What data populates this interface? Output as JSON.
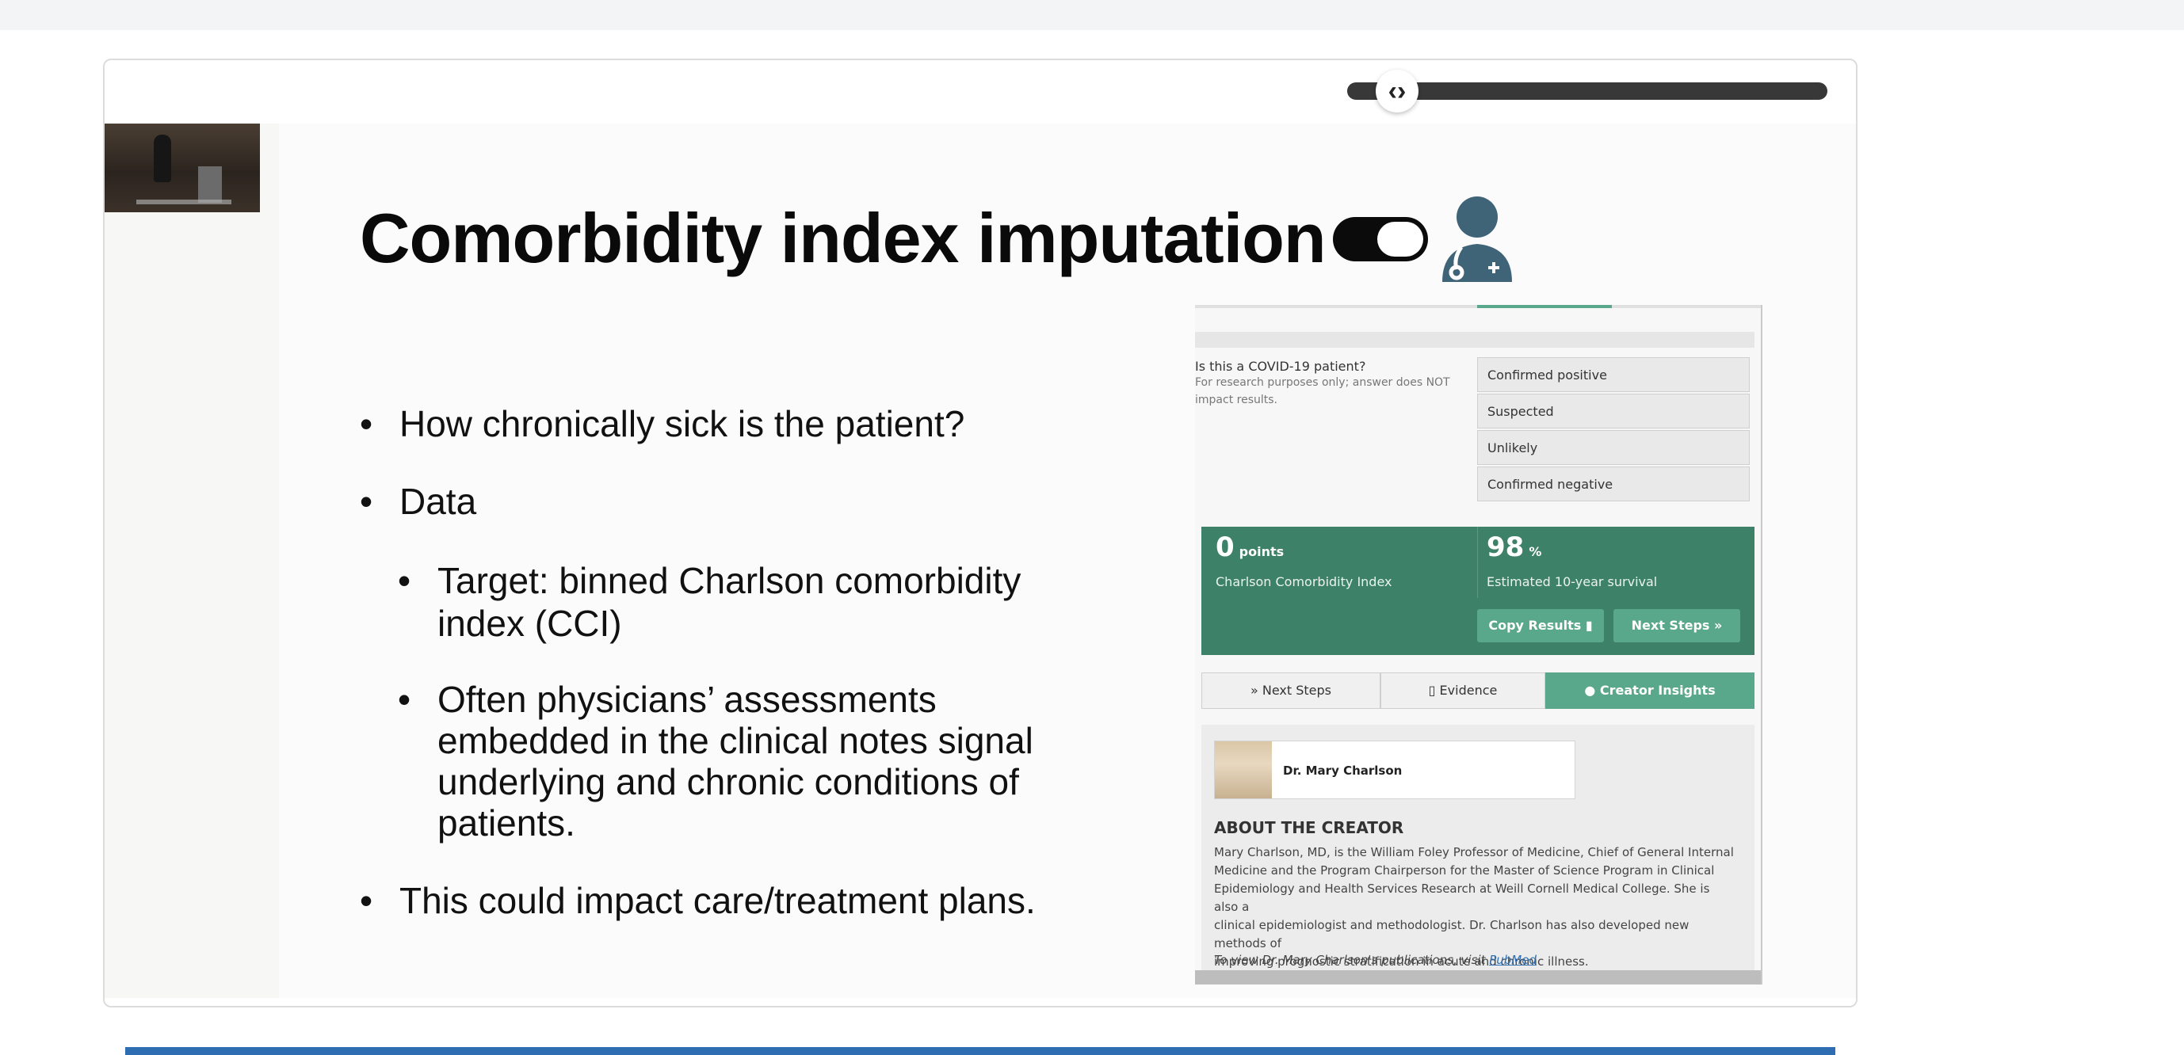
{
  "slide": {
    "title": "Comorbidity index imputation",
    "bullets": [
      {
        "level": 1,
        "text": "How chronically sick is the patient?"
      },
      {
        "level": 1,
        "text": "Data"
      },
      {
        "level": 2,
        "lines": [
          "Target: binned Charlson comorbidity",
          "index (CCI)"
        ]
      },
      {
        "level": 2,
        "lines": [
          "Often physicians’ assessments",
          "embedded in the clinical notes signal",
          "underlying and chronic conditions of",
          "patients."
        ]
      },
      {
        "level": 1,
        "text": "This could impact care/treatment plans."
      }
    ]
  },
  "calculator": {
    "covid_question": "Is this a COVID-19 patient?",
    "covid_note_line1": "For research purposes only; answer does NOT",
    "covid_note_line2": "impact results.",
    "options": [
      "Confirmed positive",
      "Suspected",
      "Unlikely",
      "Confirmed negative"
    ],
    "result_points_value": "0",
    "result_points_unit": "points",
    "result_points_label": "Charlson Comorbidity Index",
    "result_survival_value": "98",
    "result_survival_unit": "%",
    "result_survival_label": "Estimated 10-year survival",
    "copy_results": "Copy Results",
    "next_steps_button": "Next Steps",
    "tabs": [
      "Next Steps",
      "Evidence",
      "Creator Insights"
    ],
    "creator_name": "Dr. Mary Charlson",
    "about_title": "ABOUT THE CREATOR",
    "about_text_lines": [
      "Mary Charlson, MD, is the William Foley Professor of Medicine, Chief of General Internal",
      "Medicine and the Program Chairperson for the Master of Science Program in Clinical",
      "Epidemiology and Health Services Research at Weill Cornell Medical College. She is also a",
      "clinical epidemiologist and methodologist. Dr. Charlson has also developed new methods of",
      "improving prognostic stratification in acute and chronic illness."
    ],
    "pub_prefix": "To view Dr. Mary Charlson's publications, visit",
    "pub_link": "PubMed"
  },
  "icons": {
    "toggle": "toggle-icon",
    "doctor": "doctor-icon",
    "scrub": "chevron-left-right-icon"
  },
  "colors": {
    "accent_green": "#3e8169",
    "tab_green": "#5aa88b",
    "bottom_bar": "#2f6db3"
  }
}
